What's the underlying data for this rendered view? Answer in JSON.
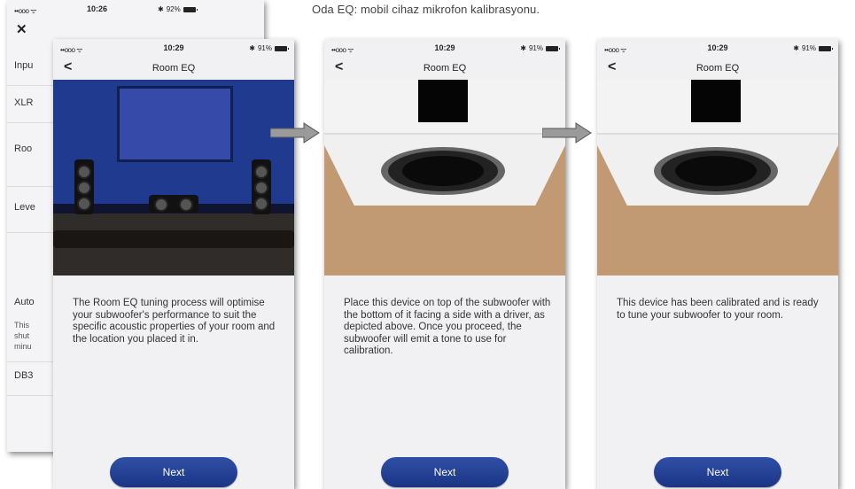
{
  "caption": "Oda EQ: mobil cihaz mikrofon kalibrasyonu.",
  "back_screen": {
    "status": {
      "signal": "••ooo ᯤ",
      "time": "10:26",
      "battery": "92%"
    },
    "close_icon": "close-icon",
    "rows": [
      "Inpu",
      "XLR",
      "Roo",
      "Leve",
      "Auto",
      "DB3"
    ],
    "auto_desc": [
      "This",
      "shut",
      "minu"
    ]
  },
  "screens": [
    {
      "status": {
        "signal": "••ooo ᯤ",
        "time": "10:29",
        "battery": "91%"
      },
      "back": "<",
      "title": "Room EQ",
      "text": "The Room EQ tuning process will optimise your subwoofer's performance to suit the specific acoustic properties of your room and the location you placed it in.",
      "button": "Next"
    },
    {
      "status": {
        "signal": "••ooo ᯤ",
        "time": "10:29",
        "battery": "91%"
      },
      "back": "<",
      "title": "Room EQ",
      "text": "Place this device on top of the subwoofer with the bottom of it facing a side with a driver, as depicted above. Once you proceed, the subwoofer will emit a tone to use for calibration.",
      "button": "Next"
    },
    {
      "status": {
        "signal": "••ooo ᯤ",
        "time": "10:29",
        "battery": "91%"
      },
      "back": "<",
      "title": "Room EQ",
      "text": "This device has been calibrated and is ready to tune your subwoofer to your room.",
      "button": "Next"
    }
  ],
  "colors": {
    "button": "#1f3a8f",
    "background": "#f1f1f4"
  }
}
